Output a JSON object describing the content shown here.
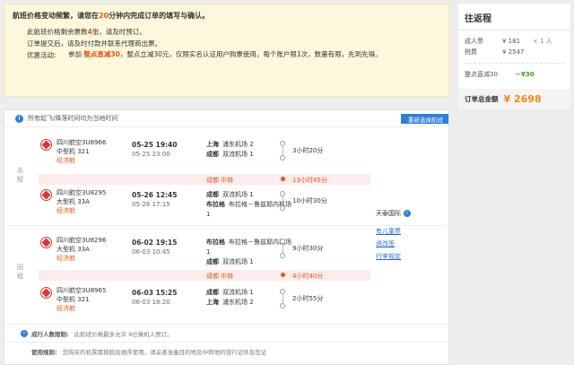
{
  "notice": {
    "head_pre": "航班价格变动频繁，请您在",
    "head_num": "20",
    "head_post": "分钟内完成订单的填写与确认。",
    "line1_pre": "此航班价格剩余票数",
    "line1_num": "4",
    "line1_post": "张，请及时预订。",
    "line2": "订单提交后，请及时付款并联系代理商出票。",
    "promo_label": "优惠活动:",
    "promo_pre": "参加",
    "promo_hl": "整点直减30",
    "promo_post": "，整点立减30元，仅限实名认证用户购票使用，每个账户限1次，数量有限，先到先得。"
  },
  "summary": {
    "title": "往返程",
    "adult_label": "成人票",
    "adult_price": "¥ 181",
    "adult_mult": "× 1 人",
    "tax_label": "税费",
    "tax_price": "¥ 2547",
    "promo_label": "整点直减30",
    "promo_value": "－¥30",
    "total_label": "订单总金额",
    "total_value": "¥ 2698"
  },
  "panel": {
    "timezone_note": "所有起飞/降落时间均为当地时间",
    "rechoose": "重新选择航班",
    "outbound_label": "去程",
    "return_label": "回程",
    "flights": [
      {
        "airline": "四川航空3U8966",
        "aircraft": "中型机 321",
        "cabin": "经济舱",
        "dep_time": "05-25 19:40",
        "arr_time": "05-25 23:00",
        "dep_city": "上海",
        "dep_airport": "浦东机场 2",
        "arr_city": "成都",
        "arr_airport": "双流机场 1",
        "duration": "3小时20分"
      },
      {
        "airline": "四川航空3U8295",
        "aircraft": "大型机 33A",
        "cabin": "经济舱",
        "dep_time": "05-26 12:45",
        "arr_time": "05-26 17:15",
        "dep_city": "成都",
        "dep_airport": "双流机场 1",
        "arr_city": "布拉格",
        "arr_airport": "布拉格－鲁兹耶内机场 1",
        "duration": "10小时30分"
      },
      {
        "airline": "四川航空3U8296",
        "aircraft": "大型机 33A",
        "cabin": "经济舱",
        "dep_time": "06-02 19:15",
        "arr_time": "06-03 10:45",
        "dep_city": "布拉格",
        "dep_airport": "布拉格－鲁兹耶内机场 1",
        "arr_city": "成都",
        "arr_airport": "双流机场 1",
        "duration": "9小时30分"
      },
      {
        "airline": "四川航空3U8965",
        "aircraft": "中型机 321",
        "cabin": "经济舱",
        "dep_time": "06-03 15:25",
        "arr_time": "06-03 18:20",
        "dep_city": "成都",
        "dep_airport": "双流机场 1",
        "arr_city": "上海",
        "arr_airport": "浦东机场 2",
        "duration": "2小时55分"
      }
    ],
    "transfers": [
      {
        "city": "成都 中转",
        "time": "13小时45分"
      },
      {
        "city": "成都 中转",
        "time": "4小时40分"
      }
    ],
    "side": {
      "brand": "天泰国际",
      "links": [
        "有儿童票",
        "退改签",
        "行李规定"
      ]
    },
    "footer": {
      "adult_label": "成行人数限制:",
      "adult_text": "此航班价格最多允许 9位乘机人预订。",
      "usage_label": "使用规则:",
      "usage_text": "您购买的机票需按航段顺序使用，请妥善准备目的地及中转地的旅行证件及签证"
    }
  },
  "colors": {
    "accent": "#e0551b",
    "link": "#2e6fc9",
    "brand_blue": "#2e7fd9",
    "total": "#f08a12",
    "notice_bg": "#fdf8dc"
  }
}
